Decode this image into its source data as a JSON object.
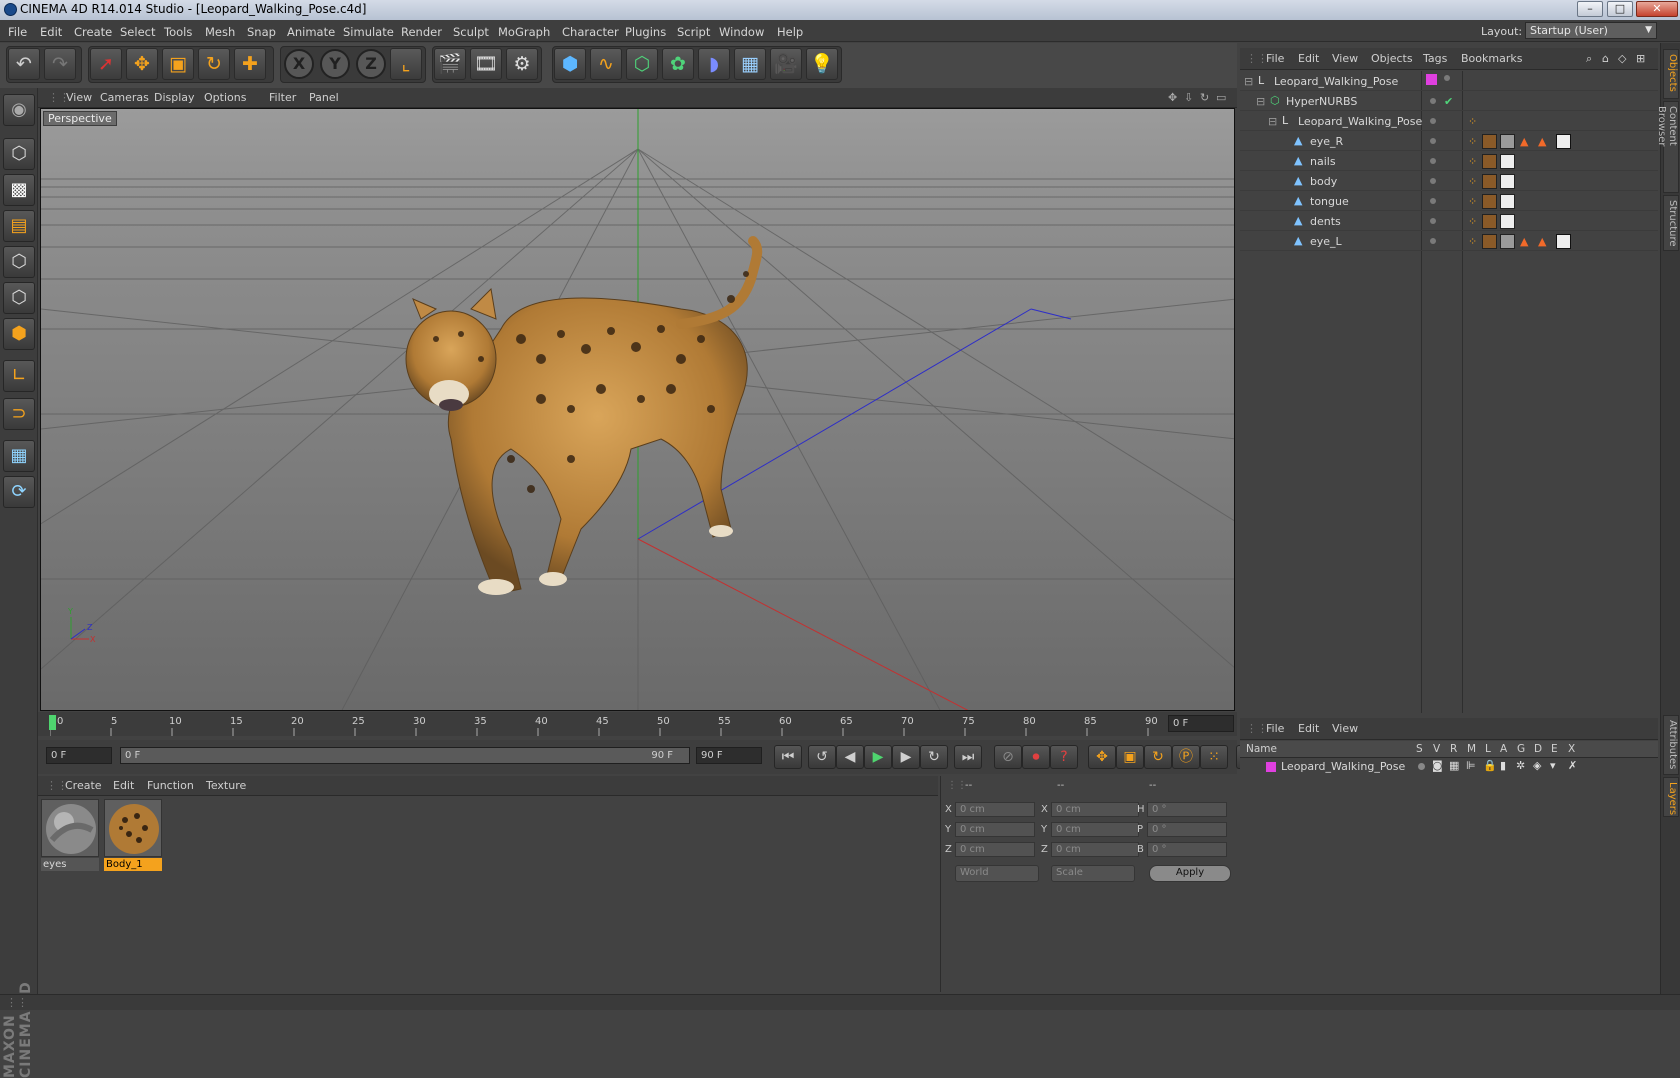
{
  "window": {
    "title": "CINEMA 4D R14.014 Studio - [Leopard_Walking_Pose.c4d]",
    "minimize": "–",
    "maximize": "□",
    "close": "✕"
  },
  "menubar": {
    "items": [
      "File",
      "Edit",
      "Create",
      "Select",
      "Tools",
      "Mesh",
      "Snap",
      "Animate",
      "Simulate",
      "Render",
      "Sculpt",
      "MoGraph",
      "Character",
      "Plugins",
      "Script",
      "Window",
      "Help"
    ],
    "layout_label": "Layout:",
    "layout_value": "Startup (User)"
  },
  "viewport": {
    "menu": [
      "View",
      "Cameras",
      "Display",
      "Options",
      "Filter",
      "Panel"
    ],
    "label": "Perspective",
    "axis": {
      "x": "X",
      "y": "Y",
      "z": "Z"
    }
  },
  "timeline": {
    "ticks": [
      "0",
      "5",
      "10",
      "15",
      "20",
      "25",
      "30",
      "35",
      "40",
      "45",
      "50",
      "55",
      "60",
      "65",
      "70",
      "75",
      "80",
      "85",
      "90"
    ],
    "current_frame": "0 F"
  },
  "transport": {
    "start_field": "0 F",
    "range_start": "0 F",
    "range_end": "90 F",
    "end_field": "90 F"
  },
  "materials": {
    "menu": [
      "Create",
      "Edit",
      "Function",
      "Texture"
    ],
    "items": [
      {
        "name": "eyes",
        "selected": false
      },
      {
        "name": "Body_1",
        "selected": true
      }
    ]
  },
  "coordinates": {
    "header": [
      "--",
      "--",
      "--"
    ],
    "rows": [
      {
        "a": "X",
        "av": "0 cm",
        "b": "X",
        "bv": "0 cm",
        "c": "H",
        "cv": "0 °"
      },
      {
        "a": "Y",
        "av": "0 cm",
        "b": "Y",
        "bv": "0 cm",
        "c": "P",
        "cv": "0 °"
      },
      {
        "a": "Z",
        "av": "0 cm",
        "b": "Z",
        "bv": "0 cm",
        "c": "B",
        "cv": "0 °"
      }
    ],
    "mode1": "World",
    "mode2": "Scale",
    "apply": "Apply"
  },
  "objects": {
    "menu": [
      "File",
      "Edit",
      "View",
      "Objects",
      "Tags",
      "Bookmarks"
    ],
    "tree": [
      {
        "name": "Leopard_Walking_Pose",
        "indent": 0,
        "icon": "null-object-icon"
      },
      {
        "name": "HyperNURBS",
        "indent": 1,
        "icon": "hypernurbs-icon"
      },
      {
        "name": "Leopard_Walking_Pose",
        "indent": 2,
        "icon": "null-object-icon"
      },
      {
        "name": "eye_R",
        "indent": 3,
        "icon": "polygon-object-icon"
      },
      {
        "name": "nails",
        "indent": 3,
        "icon": "polygon-object-icon"
      },
      {
        "name": "body",
        "indent": 3,
        "icon": "polygon-object-icon"
      },
      {
        "name": "tongue",
        "indent": 3,
        "icon": "polygon-object-icon"
      },
      {
        "name": "dents",
        "indent": 3,
        "icon": "polygon-object-icon"
      },
      {
        "name": "eye_L",
        "indent": 3,
        "icon": "polygon-object-icon"
      }
    ]
  },
  "layers": {
    "menu": [
      "File",
      "Edit",
      "View"
    ],
    "columns": [
      "Name",
      "S",
      "V",
      "R",
      "M",
      "L",
      "A",
      "G",
      "D",
      "E",
      "X"
    ],
    "rows": [
      {
        "name": "Leopard_Walking_Pose",
        "color": "#e040e0"
      }
    ]
  },
  "sidetabs": [
    "Objects",
    "Content Browser",
    "Structure",
    "Attributes",
    "Layers"
  ],
  "brand": "MAXON CINEMA 4D",
  "colors": {
    "accent": "#f4a21d",
    "layer_magenta": "#e040e0"
  }
}
